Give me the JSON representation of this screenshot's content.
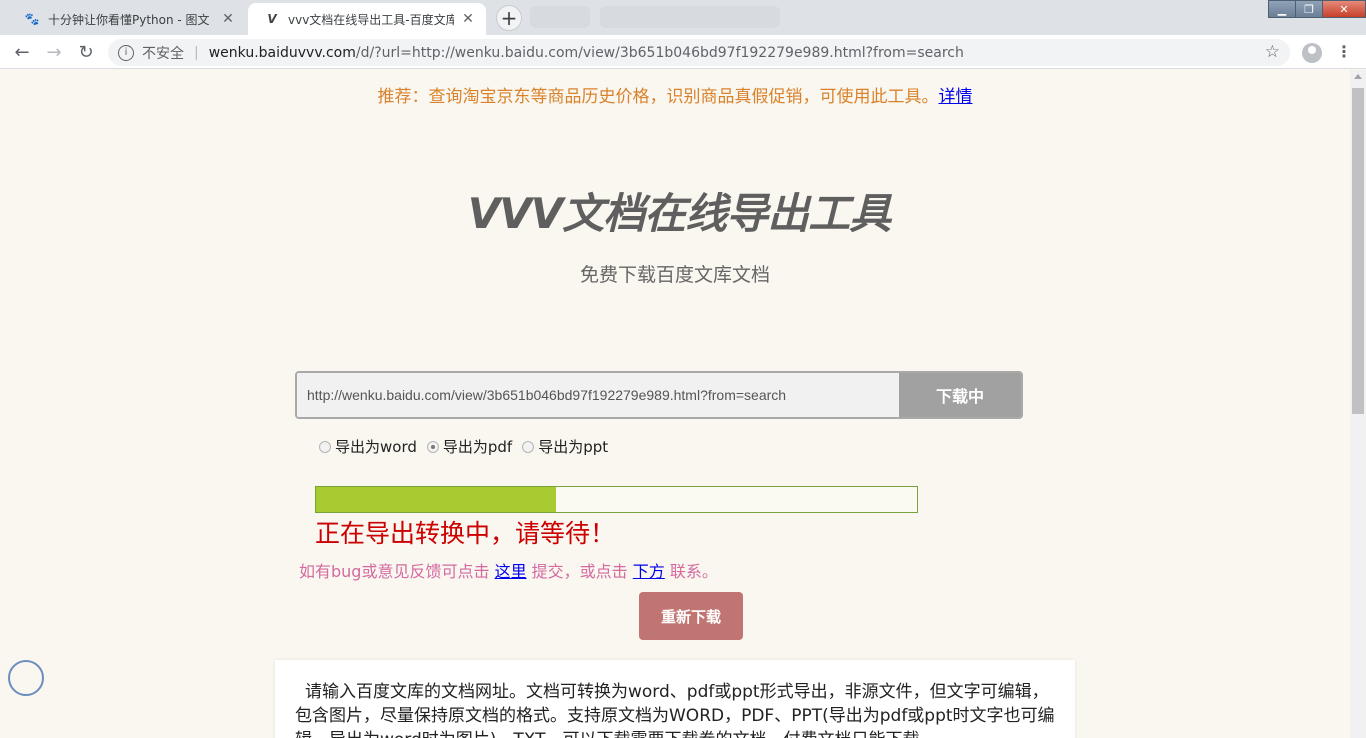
{
  "browser": {
    "tabs": [
      {
        "title": "十分钟让你看懂Python - 图文 -",
        "favicon": "baidu-paw-icon",
        "active": false
      },
      {
        "title": "vvv文档在线导出工具-百度文库下",
        "favicon": "v-logo-icon",
        "active": true
      }
    ],
    "window_controls": {
      "minimize": "▁",
      "maximize": "❐",
      "close": "✕"
    },
    "address": {
      "security_label": "不安全",
      "domain": "wenku.baiduvvv.com",
      "path": "/d/?url=http://wenku.baidu.com/view/3b651b046bd97f192279e989.html?from=search"
    }
  },
  "page": {
    "promo": {
      "text": "推荐：查询淘宝京东等商品历史价格，识别商品真假促销，可使用此工具。",
      "link": "详情"
    },
    "title": "VVV文档在线导出工具",
    "subtitle": "免费下载百度文库文档",
    "search": {
      "value": "http://wenku.baidu.com/view/3b651b046bd97f192279e989.html?from=search",
      "button_label": "下载中"
    },
    "export_options": [
      {
        "label": "导出为word",
        "checked": false
      },
      {
        "label": "导出为pdf",
        "checked": true
      },
      {
        "label": "导出为ppt",
        "checked": false
      }
    ],
    "progress": {
      "fraction": 0.4
    },
    "status": "正在导出转换中，请等待！",
    "feedback": {
      "prefix": "如有bug或意见反馈可点击",
      "link1": "这里",
      "middle": "提交，或点击",
      "link2": "下方",
      "suffix": "联系。"
    },
    "retry_button": "重新下载",
    "description": "请输入百度文库的文档网址。文档可转换为word、pdf或ppt形式导出，非源文件，但文字可编辑，包含图片，尽量保持原文档的格式。支持原文档为WORD，PDF、PPT(导出为pdf或ppt时文字也可编辑，导出为word时为图片)，TXT。可以下载需要下载券的文档，付费文档只能下载"
  },
  "colors": {
    "accent_green": "#a8cb32",
    "status_red": "#cc0000",
    "retry_button": "#c07572",
    "promo_orange": "#d9822b"
  }
}
